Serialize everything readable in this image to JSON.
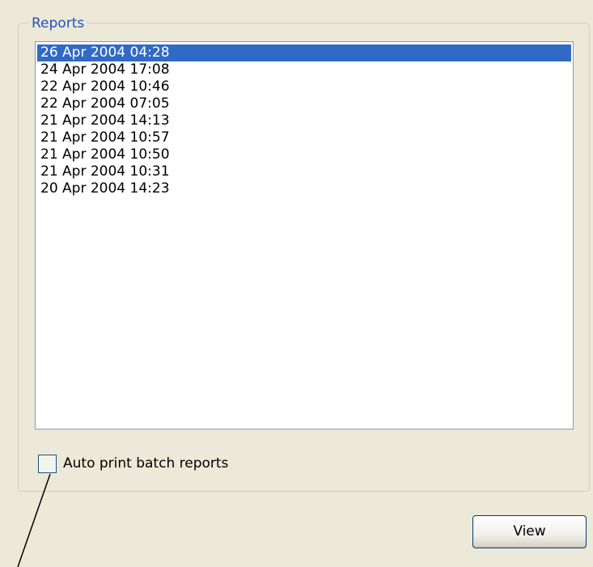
{
  "reports": {
    "title": "Reports",
    "items": [
      {
        "label": "26 Apr 2004 04:28",
        "selected": true
      },
      {
        "label": "24 Apr 2004 17:08"
      },
      {
        "label": "22 Apr 2004 10:46"
      },
      {
        "label": "22 Apr 2004 07:05"
      },
      {
        "label": "21 Apr 2004 14:13"
      },
      {
        "label": "21 Apr 2004 10:57"
      },
      {
        "label": "21 Apr 2004 10:50"
      },
      {
        "label": "21 Apr 2004 10:31"
      },
      {
        "label": "20 Apr 2004 14:23"
      }
    ]
  },
  "auto_print": {
    "label": "Auto print batch reports",
    "checked": false
  },
  "view_button": {
    "label": "View"
  },
  "colors": {
    "selection": "#316ac5",
    "group_title": "#2452b8",
    "panel": "#ece9d8"
  }
}
